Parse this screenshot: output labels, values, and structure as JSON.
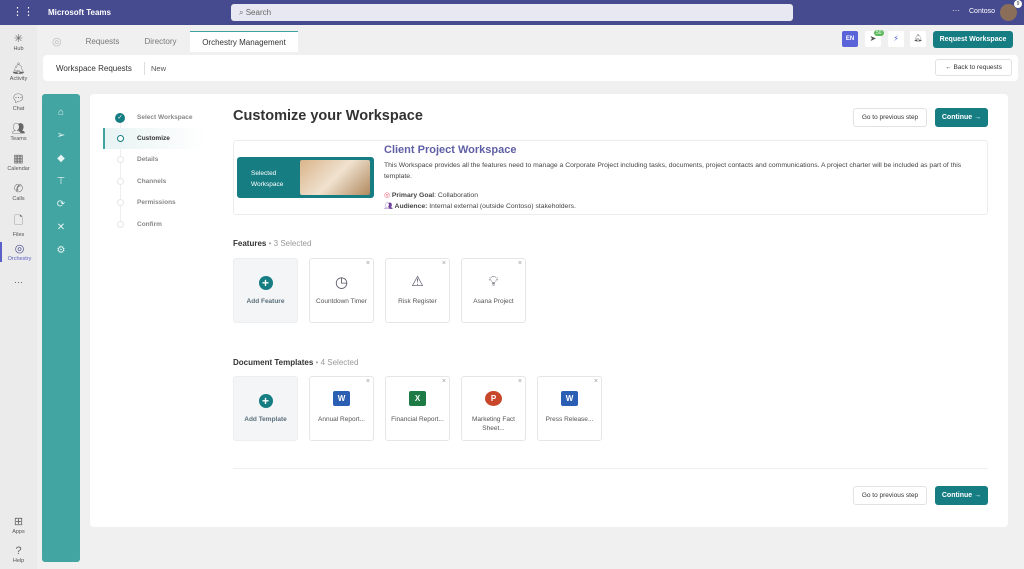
{
  "app": {
    "title": "Microsoft Teams",
    "search_placeholder": "Search",
    "more": "···",
    "org": "Contoso",
    "avatar_badge": "9"
  },
  "rail": [
    {
      "label": "Hub",
      "icon": "hub-icon"
    },
    {
      "label": "Activity",
      "icon": "bell-icon"
    },
    {
      "label": "Chat",
      "icon": "chat-icon"
    },
    {
      "label": "Teams",
      "icon": "teams-icon"
    },
    {
      "label": "Calendar",
      "icon": "calendar-icon"
    },
    {
      "label": "Calls",
      "icon": "phone-icon"
    },
    {
      "label": "Files",
      "icon": "file-icon"
    },
    {
      "label": "Orchestry",
      "icon": "orchestry-icon"
    }
  ],
  "rail_more": "···",
  "rail_bottom": [
    {
      "label": "Apps"
    },
    {
      "label": "Help"
    }
  ],
  "tabs": [
    {
      "label": "Requests"
    },
    {
      "label": "Directory"
    },
    {
      "label": "Orchestry Management"
    }
  ],
  "header": {
    "lang": "EN",
    "notif_count": "50",
    "request_button": "Request Workspace",
    "breadcrumb": "Workspace Requests",
    "sub": "New",
    "back": "Back to requests"
  },
  "steps": [
    {
      "label": "Select Workspace",
      "state": "done"
    },
    {
      "label": "Customize",
      "state": "active"
    },
    {
      "label": "Details"
    },
    {
      "label": "Channels"
    },
    {
      "label": "Permissions"
    },
    {
      "label": "Confirm"
    }
  ],
  "main": {
    "title": "Customize your Workspace",
    "prev": "Go to previous step",
    "continue": "Continue",
    "workspace": {
      "badge": "Selected Workspace",
      "name": "Client Project Workspace",
      "description": "This Workspace provides all the features need to manage a Corporate Project including tasks, documents, project contacts and communications. A project charter will be included as part of this template.",
      "goal_label": "Primary Goal",
      "goal": ": Collaboration",
      "audience_label": "Audience:",
      "audience": " Internal external (outside Contoso) stakeholders."
    },
    "features": {
      "title": "Features",
      "count": "3 Selected",
      "add": "Add Feature",
      "items": [
        {
          "label": "Countdown Timer"
        },
        {
          "label": "Risk Register"
        },
        {
          "label": "Asana Project"
        }
      ]
    },
    "templates": {
      "title": "Document Templates",
      "count": "4 Selected",
      "add": "Add Template",
      "items": [
        {
          "label": "Annual Report...",
          "app": "W",
          "color": "#2b5fb4"
        },
        {
          "label": "Financial Report...",
          "app": "X",
          "color": "#1e7b45"
        },
        {
          "label": "Marketing Fact Sheet...",
          "app": "P",
          "color": "#c8472a"
        },
        {
          "label": "Press Release...",
          "app": "W",
          "color": "#2b5fb4"
        }
      ]
    }
  },
  "colors": {
    "teal": "#167d83",
    "purple": "#464a8f",
    "side": "#42a5a1"
  }
}
